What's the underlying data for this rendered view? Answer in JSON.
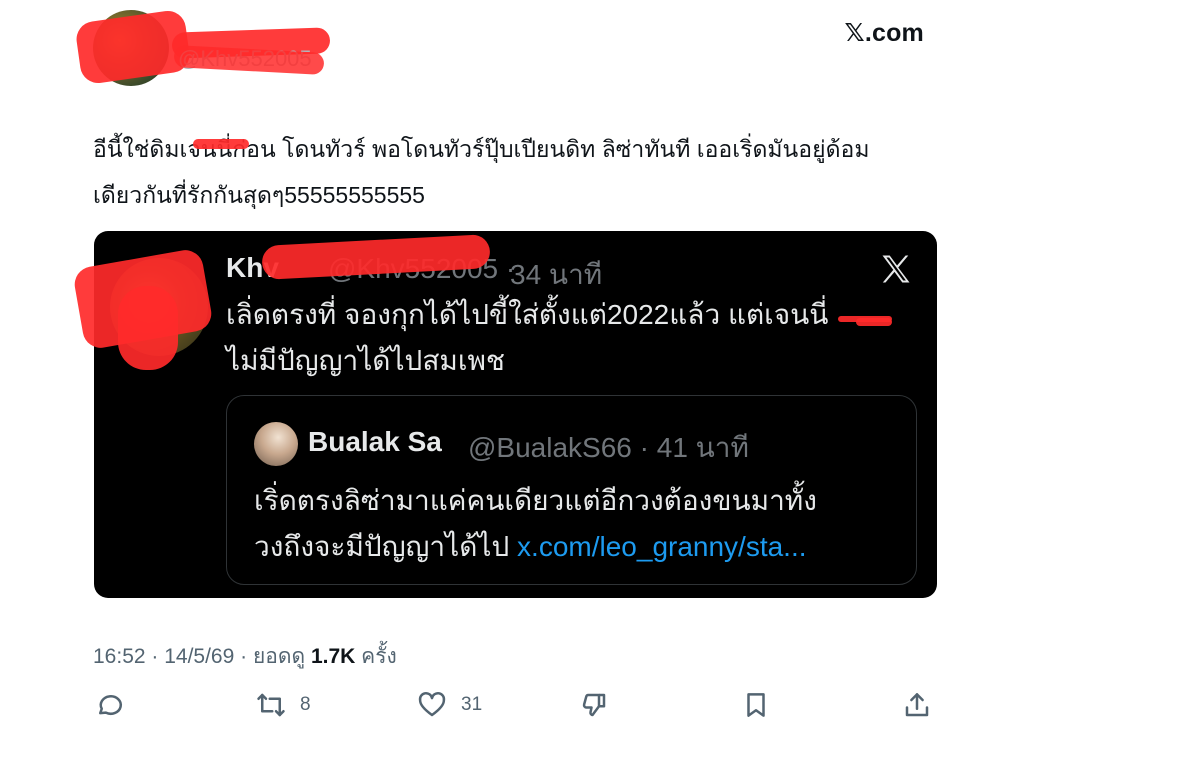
{
  "site_logo": "𝕏.com",
  "author": {
    "handle": "@Khv552005"
  },
  "tweet": {
    "text": "อีนี้ใช่ดิมเจนนี่ก่อน โดนทัวร์ พอโดนทัวร์ปุ๊บเปียนดิท ลิซ่าทันที เออเริ่ดมันอยู่ด้อม\nเดียวกันที่รักกันสุดๆ55555555555"
  },
  "embedded": {
    "name": "Khv",
    "meta": "@Khv552005 ·",
    "time": "34 นาที",
    "text": "เลิ่ดตรงที่ จองกุกได้ไปขี้ใส่ตั้งแต่2022แล้ว แต่เจนนี่\nไม่มีปัญญาได้ไปสมเพช",
    "quote": {
      "name": "Bualak Sa",
      "handle": "@BualakS66 · 41 นาที",
      "text": "เริ่ดตรงลิซ่ามาแค่คนเดียวแต่อีกวงต้องขนมาทั้ง\nวงถึงจะมีปัญญาได้ไป ",
      "link": "x.com/leo_granny/sta..."
    }
  },
  "meta": {
    "time": "16:52 · 14/5/69 · ยอดดู ",
    "views": "1.7K",
    "views_suffix": " ครั้ง"
  },
  "actions": {
    "reply_icon": "reply-icon",
    "retweet_count": "8",
    "like_count": "31",
    "downvote_icon": "thumbs-down-icon",
    "bookmark_icon": "bookmark-icon",
    "share_icon": "share-icon"
  },
  "colors": {
    "card_bg": "#000000",
    "link": "#1d9bf0",
    "redaction": "#ff2a2a",
    "secondary_text": "#536471"
  }
}
